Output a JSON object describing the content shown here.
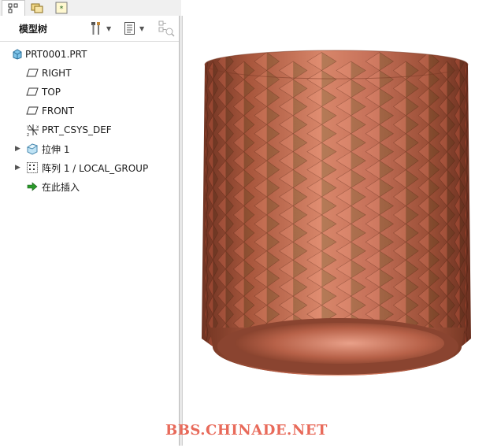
{
  "tabs": [
    {
      "icon": "model-tree-tab-icon"
    },
    {
      "icon": "folder-browser-tab-icon"
    },
    {
      "icon": "favorites-tab-icon"
    }
  ],
  "panel": {
    "title": "模型树",
    "toolbar": [
      "settings-tools-icon",
      "show-options-icon",
      "filter-display-icon"
    ]
  },
  "tree": {
    "root": "PRT0001.PRT",
    "items": [
      {
        "label": "RIGHT",
        "icon": "datum-plane-icon"
      },
      {
        "label": "TOP",
        "icon": "datum-plane-icon"
      },
      {
        "label": "FRONT",
        "icon": "datum-plane-icon"
      },
      {
        "label": "PRT_CSYS_DEF",
        "icon": "coordinate-system-icon"
      },
      {
        "label": "拉伸 1",
        "icon": "extrude-feature-icon",
        "expandable": true
      },
      {
        "label": "阵列 1 / LOCAL_GROUP",
        "icon": "pattern-feature-icon",
        "expandable": true
      },
      {
        "label": "在此插入",
        "icon": "insert-here-arrow-icon"
      }
    ]
  },
  "colors": {
    "model_base": "#c06a4e",
    "model_light": "#e8a084",
    "model_dark": "#7a3a26",
    "watermark": "#e86a5a"
  },
  "watermark": "BBS.CHINADE.NET"
}
